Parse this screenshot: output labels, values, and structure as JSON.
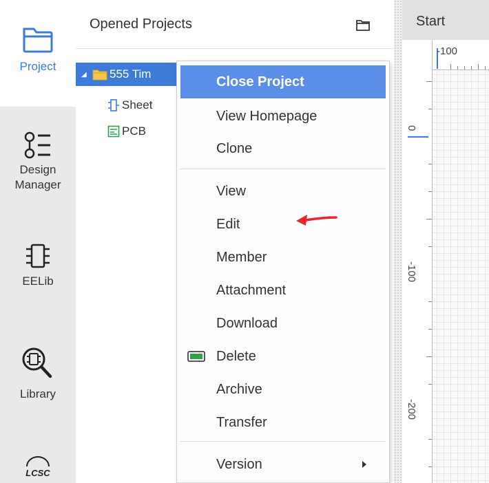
{
  "rail": {
    "items": [
      {
        "label": "Project",
        "icon": "folder-icon",
        "active": true
      },
      {
        "label": "Design Manager",
        "icon": "list-icon"
      },
      {
        "label": "EELib",
        "icon": "chip-icon"
      },
      {
        "label": "Library",
        "icon": "magnify-chip-icon"
      },
      {
        "label": "LCSC",
        "icon": "lcsc-logo-icon"
      }
    ]
  },
  "panel": {
    "title": "Opened Projects",
    "tree": [
      {
        "label": "555 Tim",
        "icon": "folder-icon",
        "selected": true
      },
      {
        "label": "Sheet",
        "icon": "schematic-icon"
      },
      {
        "label": "PCB",
        "icon": "pcb-icon"
      }
    ]
  },
  "canvas": {
    "tab": "Start",
    "ruler_top_label": "-100",
    "ruler_left_labels": [
      "0",
      "-100",
      "-200"
    ]
  },
  "menu": {
    "items": [
      {
        "label": "Close Project",
        "highlight": true
      },
      {
        "label": "View Homepage"
      },
      {
        "label": "Clone"
      },
      {
        "label": "View"
      },
      {
        "label": "Edit"
      },
      {
        "label": "Member"
      },
      {
        "label": "Attachment"
      },
      {
        "label": "Download"
      },
      {
        "label": "Delete",
        "icon": "delete-icon"
      },
      {
        "label": "Archive"
      },
      {
        "label": "Transfer"
      },
      {
        "label": "Version",
        "submenu": true
      }
    ]
  },
  "colors": {
    "accent": "#3d7bd9",
    "menu_highlight": "#5b8ee6",
    "annotation_arrow": "#e8262b",
    "delete_icon": "#2fa34a"
  }
}
